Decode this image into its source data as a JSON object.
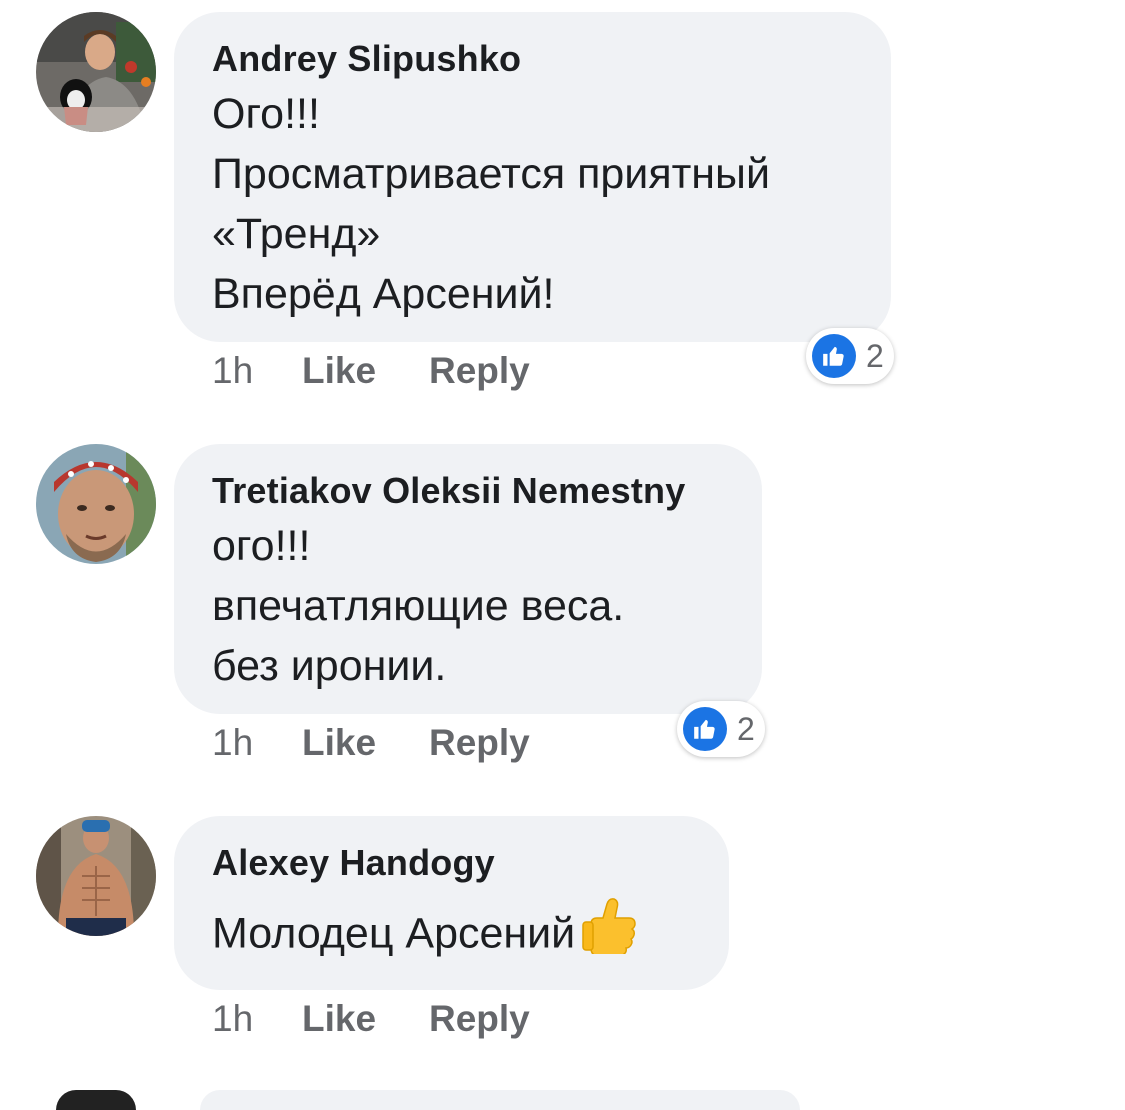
{
  "comments": [
    {
      "author": "Andrey Slipushko",
      "lines": [
        "Ого!!!",
        "Просматривается приятный",
        "«Тренд»",
        "Вперёд Арсений!"
      ],
      "time": "1h",
      "like_label": "Like",
      "reply_label": "Reply",
      "reaction_count": "2",
      "avatar_icon": "profile-photo"
    },
    {
      "author": "Tretiakov Oleksii Nemestny",
      "lines": [
        "ого!!!",
        "впечатляющие веса.",
        "без иронии."
      ],
      "time": "1h",
      "like_label": "Like",
      "reply_label": "Reply",
      "reaction_count": "2",
      "avatar_icon": "profile-photo"
    },
    {
      "author": "Alexey Handogy",
      "lines": [
        "Молодец Арсений"
      ],
      "emoji": "thumbs-up-emoji",
      "time": "1h",
      "like_label": "Like",
      "reply_label": "Reply",
      "avatar_icon": "profile-photo"
    }
  ],
  "colors": {
    "bubble": "#f0f2f5",
    "like_blue": "#1b74e4",
    "meta_text": "#65676b"
  }
}
